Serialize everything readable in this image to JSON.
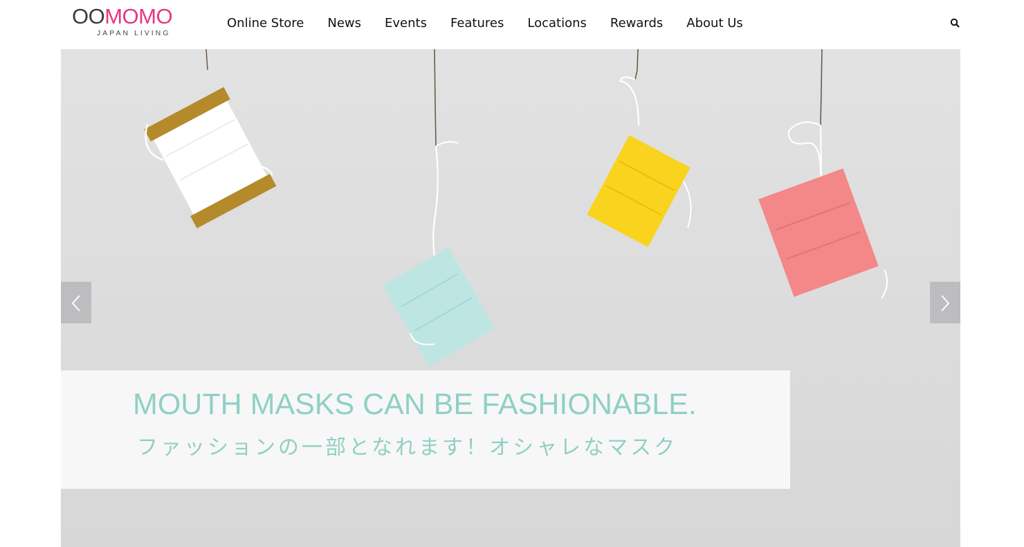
{
  "brand": {
    "name_part1": "OO",
    "name_part2": "MOMO",
    "tagline": "JAPAN LIVING",
    "colors": {
      "primary_dark": "#3b3b3b",
      "accent_pink": "#e6377f"
    }
  },
  "nav": {
    "items": [
      {
        "label": "Online Store"
      },
      {
        "label": "News"
      },
      {
        "label": "Events"
      },
      {
        "label": "Features"
      },
      {
        "label": "Locations"
      },
      {
        "label": "Rewards"
      },
      {
        "label": "About Us"
      }
    ],
    "search_icon": "search-icon"
  },
  "hero": {
    "headline": "MOUTH MASKS CAN BE FASHIONABLE.",
    "subheadline": "ファッションの一部となれます！オシャレなマスク",
    "caption_color": "#8fd0c5",
    "prev_icon": "chevron-left-icon",
    "next_icon": "chevron-right-icon",
    "mask_colors": [
      "#ffffff",
      "#bde6e3",
      "#f9d31e",
      "#f48787"
    ]
  }
}
